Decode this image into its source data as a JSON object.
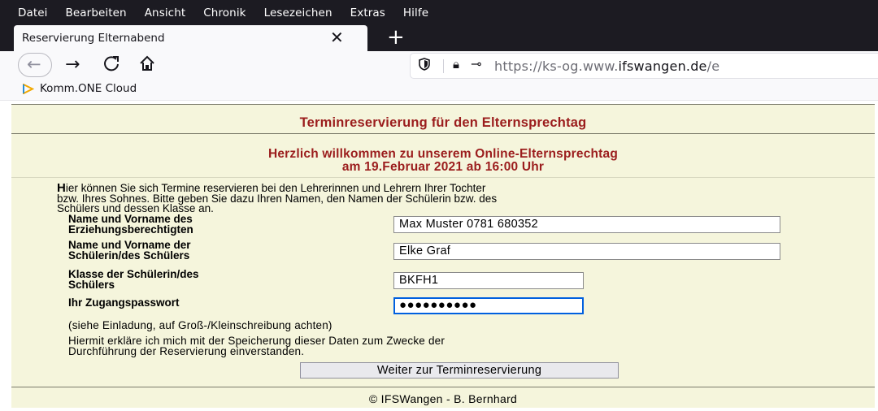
{
  "browser": {
    "menu": [
      {
        "label": "Datei"
      },
      {
        "label": "Bearbeiten"
      },
      {
        "label": "Ansicht"
      },
      {
        "label": "Chronik"
      },
      {
        "label": "Lesezeichen"
      },
      {
        "label": "Extras"
      },
      {
        "label": "Hilfe"
      }
    ],
    "tab": {
      "title": "Reservierung Elternabend"
    },
    "url": {
      "prefix": "https://ks-og.www.",
      "domain": "ifswangen.de",
      "suffix": "/e"
    },
    "bookmarks": [
      {
        "label": "Komm.ONE Cloud"
      }
    ],
    "icons": {
      "tab_close": "close-icon",
      "new_tab": "plus-icon",
      "back": "arrow-left-icon",
      "forward": "arrow-right-icon",
      "reload": "reload-icon",
      "home": "home-icon",
      "shield": "shield-icon",
      "lock": "lock-icon",
      "key": "key-icon",
      "bookmark": "cloud-icon"
    },
    "colors": {
      "chrome_dark": "#1c1b22",
      "chrome_light": "#f9f9fb"
    }
  },
  "page": {
    "heading": "Terminreservierung für den Elternsprechtag",
    "welcome_line1": "Herzlich willkommen zu unserem Online-Elternsprechtag",
    "welcome_line2": "am 19.Februar 2021 ab 16:00 Uhr",
    "intro_first_letter": "H",
    "intro_line1_rest": "ier können Sie sich Termine reservieren bei den Lehrerinnen und Lehrern Ihrer Tochter",
    "intro_line2": "bzw. Ihres Sohnes. Bitte geben Sie dazu Ihren Namen, den Namen der Schülerin bzw. des",
    "intro_line3": "Schülers und dessen Klasse an.",
    "form": {
      "parent_label_1": "Name und Vorname des",
      "parent_label_2": "Erziehungsberechtigten",
      "parent_value": "Max Muster 0781 680352",
      "student_label_1": "Name und Vorname der",
      "student_label_2": "Schülerin/des Schülers",
      "student_value": "Elke Graf",
      "class_label_1": "Klasse der Schülerin/des",
      "class_label_2": "Schülers",
      "class_value": "BKFH1",
      "password_label": "Ihr Zugangspasswort",
      "password_mask": "●●●●●●●●●●",
      "password_hint": "(siehe Einladung, auf Groß-/Kleinschreibung achten)",
      "consent_line1": "Hiermit erkläre ich mich mit der Speicherung dieser Daten zum Zwecke der",
      "consent_line2": "Durchführung der Reservierung einverstanden.",
      "submit_label": "Weiter zur Terminreservierung"
    },
    "footer": "© IFSWangen - B. Bernhard",
    "colors": {
      "background": "#f5f5dc",
      "heading": "#9b1d1d"
    }
  }
}
